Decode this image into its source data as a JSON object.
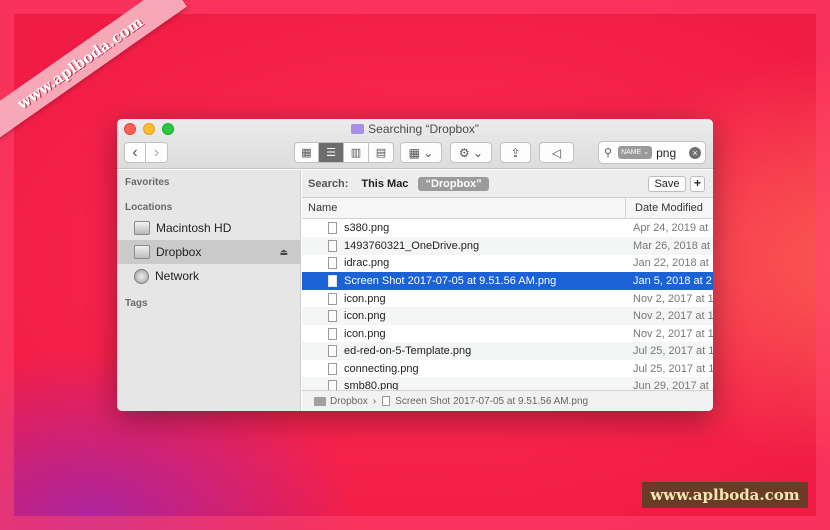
{
  "watermark": {
    "ribbon_text": "www.aplboda.com",
    "badge_text": "www.aplboda.com"
  },
  "window": {
    "title": "Searching “Dropbox”"
  },
  "toolbar": {
    "back_icon": "‹",
    "forward_icon": "›",
    "view_icons": [
      "▦",
      "☰",
      "▥",
      "▤"
    ],
    "group_icon": "▦ ⌄",
    "action_icon": "⚙ ⌄",
    "share_icon": "⇪",
    "tag_icon": "◁"
  },
  "search": {
    "token": "NAME ⌄",
    "query": "png"
  },
  "sidebar": {
    "favorites_heading": "Favorites",
    "locations_heading": "Locations",
    "tags_heading": "Tags",
    "items": [
      {
        "label": "Macintosh HD"
      },
      {
        "label": "Dropbox"
      },
      {
        "label": "Network"
      }
    ],
    "eject_icon": "⏏"
  },
  "searchbar": {
    "label": "Search:",
    "scope_this_mac": "This Mac",
    "scope_dropbox": "“Dropbox”",
    "save_label": "Save",
    "add_label": "+"
  },
  "columns": {
    "name": "Name",
    "date_modified": "Date Modified"
  },
  "files": [
    {
      "name": "s380.png",
      "date": "Apr 24, 2019 at"
    },
    {
      "name": "1493760321_OneDrive.png",
      "date": "Mar 26, 2018 at"
    },
    {
      "name": "idrac.png",
      "date": "Jan 22, 2018 at"
    },
    {
      "name": "Screen Shot 2017-07-05 at 9.51.56 AM.png",
      "date": "Jan 5, 2018 at 2"
    },
    {
      "name": "icon.png",
      "date": "Nov 2, 2017 at 1"
    },
    {
      "name": "icon.png",
      "date": "Nov 2, 2017 at 1"
    },
    {
      "name": "icon.png",
      "date": "Nov 2, 2017 at 1"
    },
    {
      "name": "ed-red-on-5-Template.png",
      "date": "Jul 25, 2017 at 1"
    },
    {
      "name": "connecting.png",
      "date": "Jul 25, 2017 at 1"
    },
    {
      "name": "smb80.png",
      "date": "Jun 29, 2017 at"
    }
  ],
  "pathbar": {
    "folder": "Dropbox",
    "separator": "›",
    "file": "Screen Shot 2017-07-05 at 9.51.56 AM.png"
  }
}
